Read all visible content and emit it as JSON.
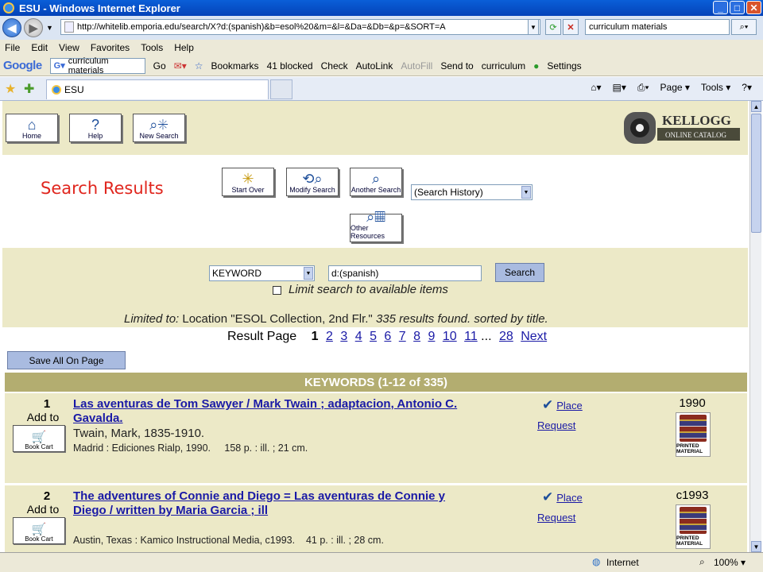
{
  "window": {
    "title": "ESU - Windows Internet Explorer"
  },
  "address": {
    "url": "http://whitelib.emporia.edu/search/X?d:(spanish)&b=esol%20&m=&l=&Da=&Db=&p=&SORT=A"
  },
  "search_box": {
    "value": "curriculum materials"
  },
  "menu": [
    "File",
    "Edit",
    "View",
    "Favorites",
    "Tools",
    "Help"
  ],
  "google_toolbar": {
    "logo": "Google",
    "query": "curriculum materials",
    "go": "Go",
    "bookmarks": "Bookmarks",
    "blocked": "41 blocked",
    "check": "Check",
    "autolink": "AutoLink",
    "autofill": "AutoFill",
    "sendto": "Send to",
    "highlight": "curriculum",
    "settings": "Settings"
  },
  "tab": {
    "label": "ESU",
    "page": "Page",
    "tools": "Tools"
  },
  "nav_buttons": {
    "home": "Home",
    "help": "Help",
    "new_search": "New Search"
  },
  "logo": {
    "name": "KELLOGG",
    "sub": "ONLINE CATALOG"
  },
  "heading": "Search Results",
  "action_buttons": {
    "start_over": "Start Over",
    "modify": "Modify Search",
    "another": "Another Search",
    "other": "Other Resources"
  },
  "history_select": "(Search History)",
  "search_form": {
    "type": "KEYWORD",
    "query": "d:(spanish)",
    "button": "Search",
    "limit_label": "Limit search to available items"
  },
  "limited": {
    "prefix": "Limited to:",
    "text": "Location \"ESOL Collection, 2nd Flr.\"",
    "count": "335 results found. sorted by title."
  },
  "result_page": {
    "label": "Result Page",
    "current": "1",
    "pages": [
      "2",
      "3",
      "4",
      "5",
      "6",
      "7",
      "8",
      "9",
      "10",
      "11"
    ],
    "ellipsis": "...",
    "last": "28",
    "next": "Next"
  },
  "save_all": "Save All On Page",
  "keywords_header": "KEYWORDS (1-12 of 335)",
  "records": [
    {
      "num": "1",
      "add_to": "Add to",
      "cart": "Book Cart",
      "title": "Las aventuras de Tom Sawyer / Mark Twain ; adaptacion, Antonio C. Gavalda.",
      "author": "Twain, Mark, 1835-1910.",
      "pub": "Madrid : Ediciones Rialp, 1990.     158 p. : ill. ; 21 cm.",
      "place": "Place",
      "request": "Request",
      "year": "1990",
      "material": "PRINTED MATERIAL"
    },
    {
      "num": "2",
      "add_to": "Add to",
      "cart": "Book Cart",
      "title": "The adventures of Connie and Diego = Las aventuras de Connie y Diego / written by Maria Garcia ; ill",
      "author": "",
      "pub": "Austin, Texas : Kamico Instructional Media, c1993.    41 p. : ill. ; 28 cm.",
      "place": "Place",
      "request": "Request",
      "year": "c1993",
      "material": "PRINTED MATERIAL"
    }
  ],
  "status": {
    "zone": "Internet",
    "zoom": "100%"
  }
}
